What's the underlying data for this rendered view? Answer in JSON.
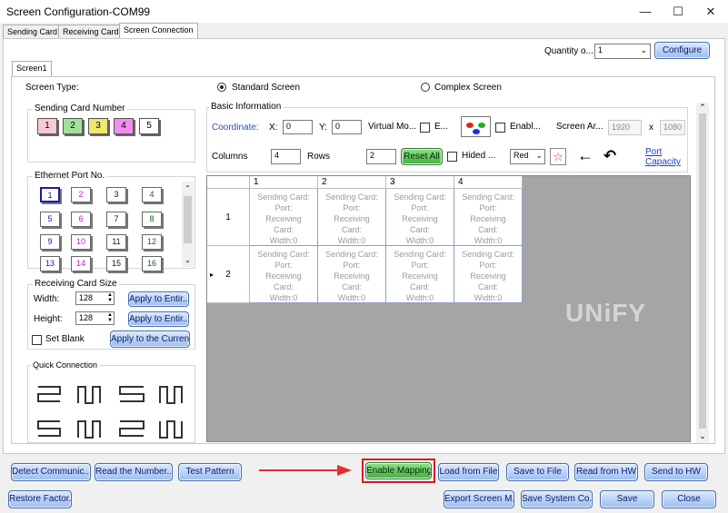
{
  "window": {
    "title": "Screen Configuration-COM99",
    "minimize": "—",
    "maximize": "☐",
    "close": "✕"
  },
  "tabs": [
    "Sending Card",
    "Receiving Card",
    "Screen Connection"
  ],
  "subtab": "Screen1",
  "quantity": {
    "label": "Quantity o...",
    "value": "1",
    "configure": "Configure"
  },
  "screen_type": {
    "label": "Screen Type:",
    "standard": "Standard Screen",
    "complex": "Complex Screen",
    "selected": "standard"
  },
  "sending_card": {
    "label": "Sending Card Number",
    "numbers": [
      "1",
      "2",
      "3",
      "4",
      "5"
    ],
    "colors": [
      "#f9c9cf",
      "#9fe39a",
      "#efe86f",
      "#f28ef2",
      "#ffffff"
    ]
  },
  "ethernet": {
    "label": "Ethernet Port No.",
    "ports": [
      "1",
      "2",
      "3",
      "4",
      "5",
      "6",
      "7",
      "8",
      "9",
      "10",
      "11",
      "12",
      "13",
      "14",
      "15",
      "16"
    ]
  },
  "receiving_size": {
    "label": "Receiving Card Size",
    "width_label": "Width:",
    "width": "128",
    "height_label": "Height:",
    "height": "128",
    "apply_width": "Apply to Entir...",
    "apply_height": "Apply to Entir...",
    "set_blank": "Set Blank",
    "apply_current": "Apply to the Curren..."
  },
  "quick_connection": {
    "label": "Quick Connection"
  },
  "basic_info": {
    "label": "Basic Information",
    "coordinate": "Coordinate:",
    "x_label": "X:",
    "x": "0",
    "y_label": "Y:",
    "y": "0",
    "virtual": "Virtual Mo...",
    "e_label": "E...",
    "enable_label": "Enabl...",
    "screen_area": "Screen Ar...",
    "area_w": "1920",
    "area_x": "x",
    "area_h": "1080",
    "columns_label": "Columns",
    "columns": "4",
    "rows_label": "Rows",
    "rows": "2",
    "reset_all": "Reset All",
    "hided": "Hided ...",
    "color": "Red",
    "port_capacity_1": "Port",
    "port_capacity_2": "Capacity"
  },
  "grid": {
    "col_headers": [
      "1",
      "2",
      "3",
      "4"
    ],
    "row_headers": [
      "1",
      "2"
    ],
    "cell_text": "Sending Card:\nPort:\nReceiving\nCard:\nWidth:0"
  },
  "watermark": "UNiFY",
  "bottom_row1": [
    "Detect Communic...",
    "Read the Number...",
    "Test Pattern"
  ],
  "enable_mapping": "Enable Mapping",
  "bottom_row1_right": [
    "Load from File",
    "Save to File",
    "Read from HW",
    "Send to HW"
  ],
  "bottom_row2_left": "Restore Factor...",
  "bottom_row2_right": [
    "Export Screen M...",
    "Save System Co...",
    "Save",
    "Close"
  ]
}
